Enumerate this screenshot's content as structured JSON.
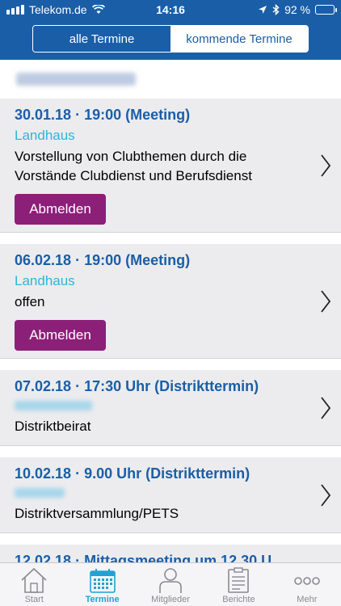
{
  "status_bar": {
    "carrier": "Telekom.de",
    "time": "14:16",
    "battery": "92 %",
    "battery_level": 0.92
  },
  "segment": {
    "all_label": "alle Termine",
    "upcoming_label": "kommende Termine"
  },
  "events": [
    {
      "date": "30.01.18 · 19:00 (Meeting)",
      "location": "Landhaus",
      "description": "Vorstellung von Clubthemen durch die Vorstände Clubdienst und Berufsdienst",
      "button": "Abmelden"
    },
    {
      "date": "06.02.18 · 19:00  (Meeting)",
      "location": "Landhaus",
      "description": "offen",
      "button": "Abmelden"
    },
    {
      "date": "07.02.18 · 17:30 Uhr (Distrikttermin)",
      "description": "Distriktbeirat"
    },
    {
      "date": "10.02.18 · 9.00 Uhr (Distrikttermin)",
      "description": "Distriktversammlung/PETS"
    },
    {
      "date": "12.02.18 · Mittagsmeeting um 12.30 U"
    }
  ],
  "tabs": [
    {
      "label": "Start",
      "icon": "home-icon"
    },
    {
      "label": "Termine",
      "icon": "calendar-icon"
    },
    {
      "label": "Mitglieder",
      "icon": "person-icon"
    },
    {
      "label": "Berichte",
      "icon": "document-icon"
    },
    {
      "label": "Mehr",
      "icon": "more-icon"
    }
  ],
  "colors": {
    "header": "#1a5ea8",
    "date_text": "#1a5ea8",
    "location_text": "#2db5d8",
    "button": "#8c1f78",
    "active_tab": "#21a2d4",
    "inactive_tab": "#8a8a8e"
  }
}
